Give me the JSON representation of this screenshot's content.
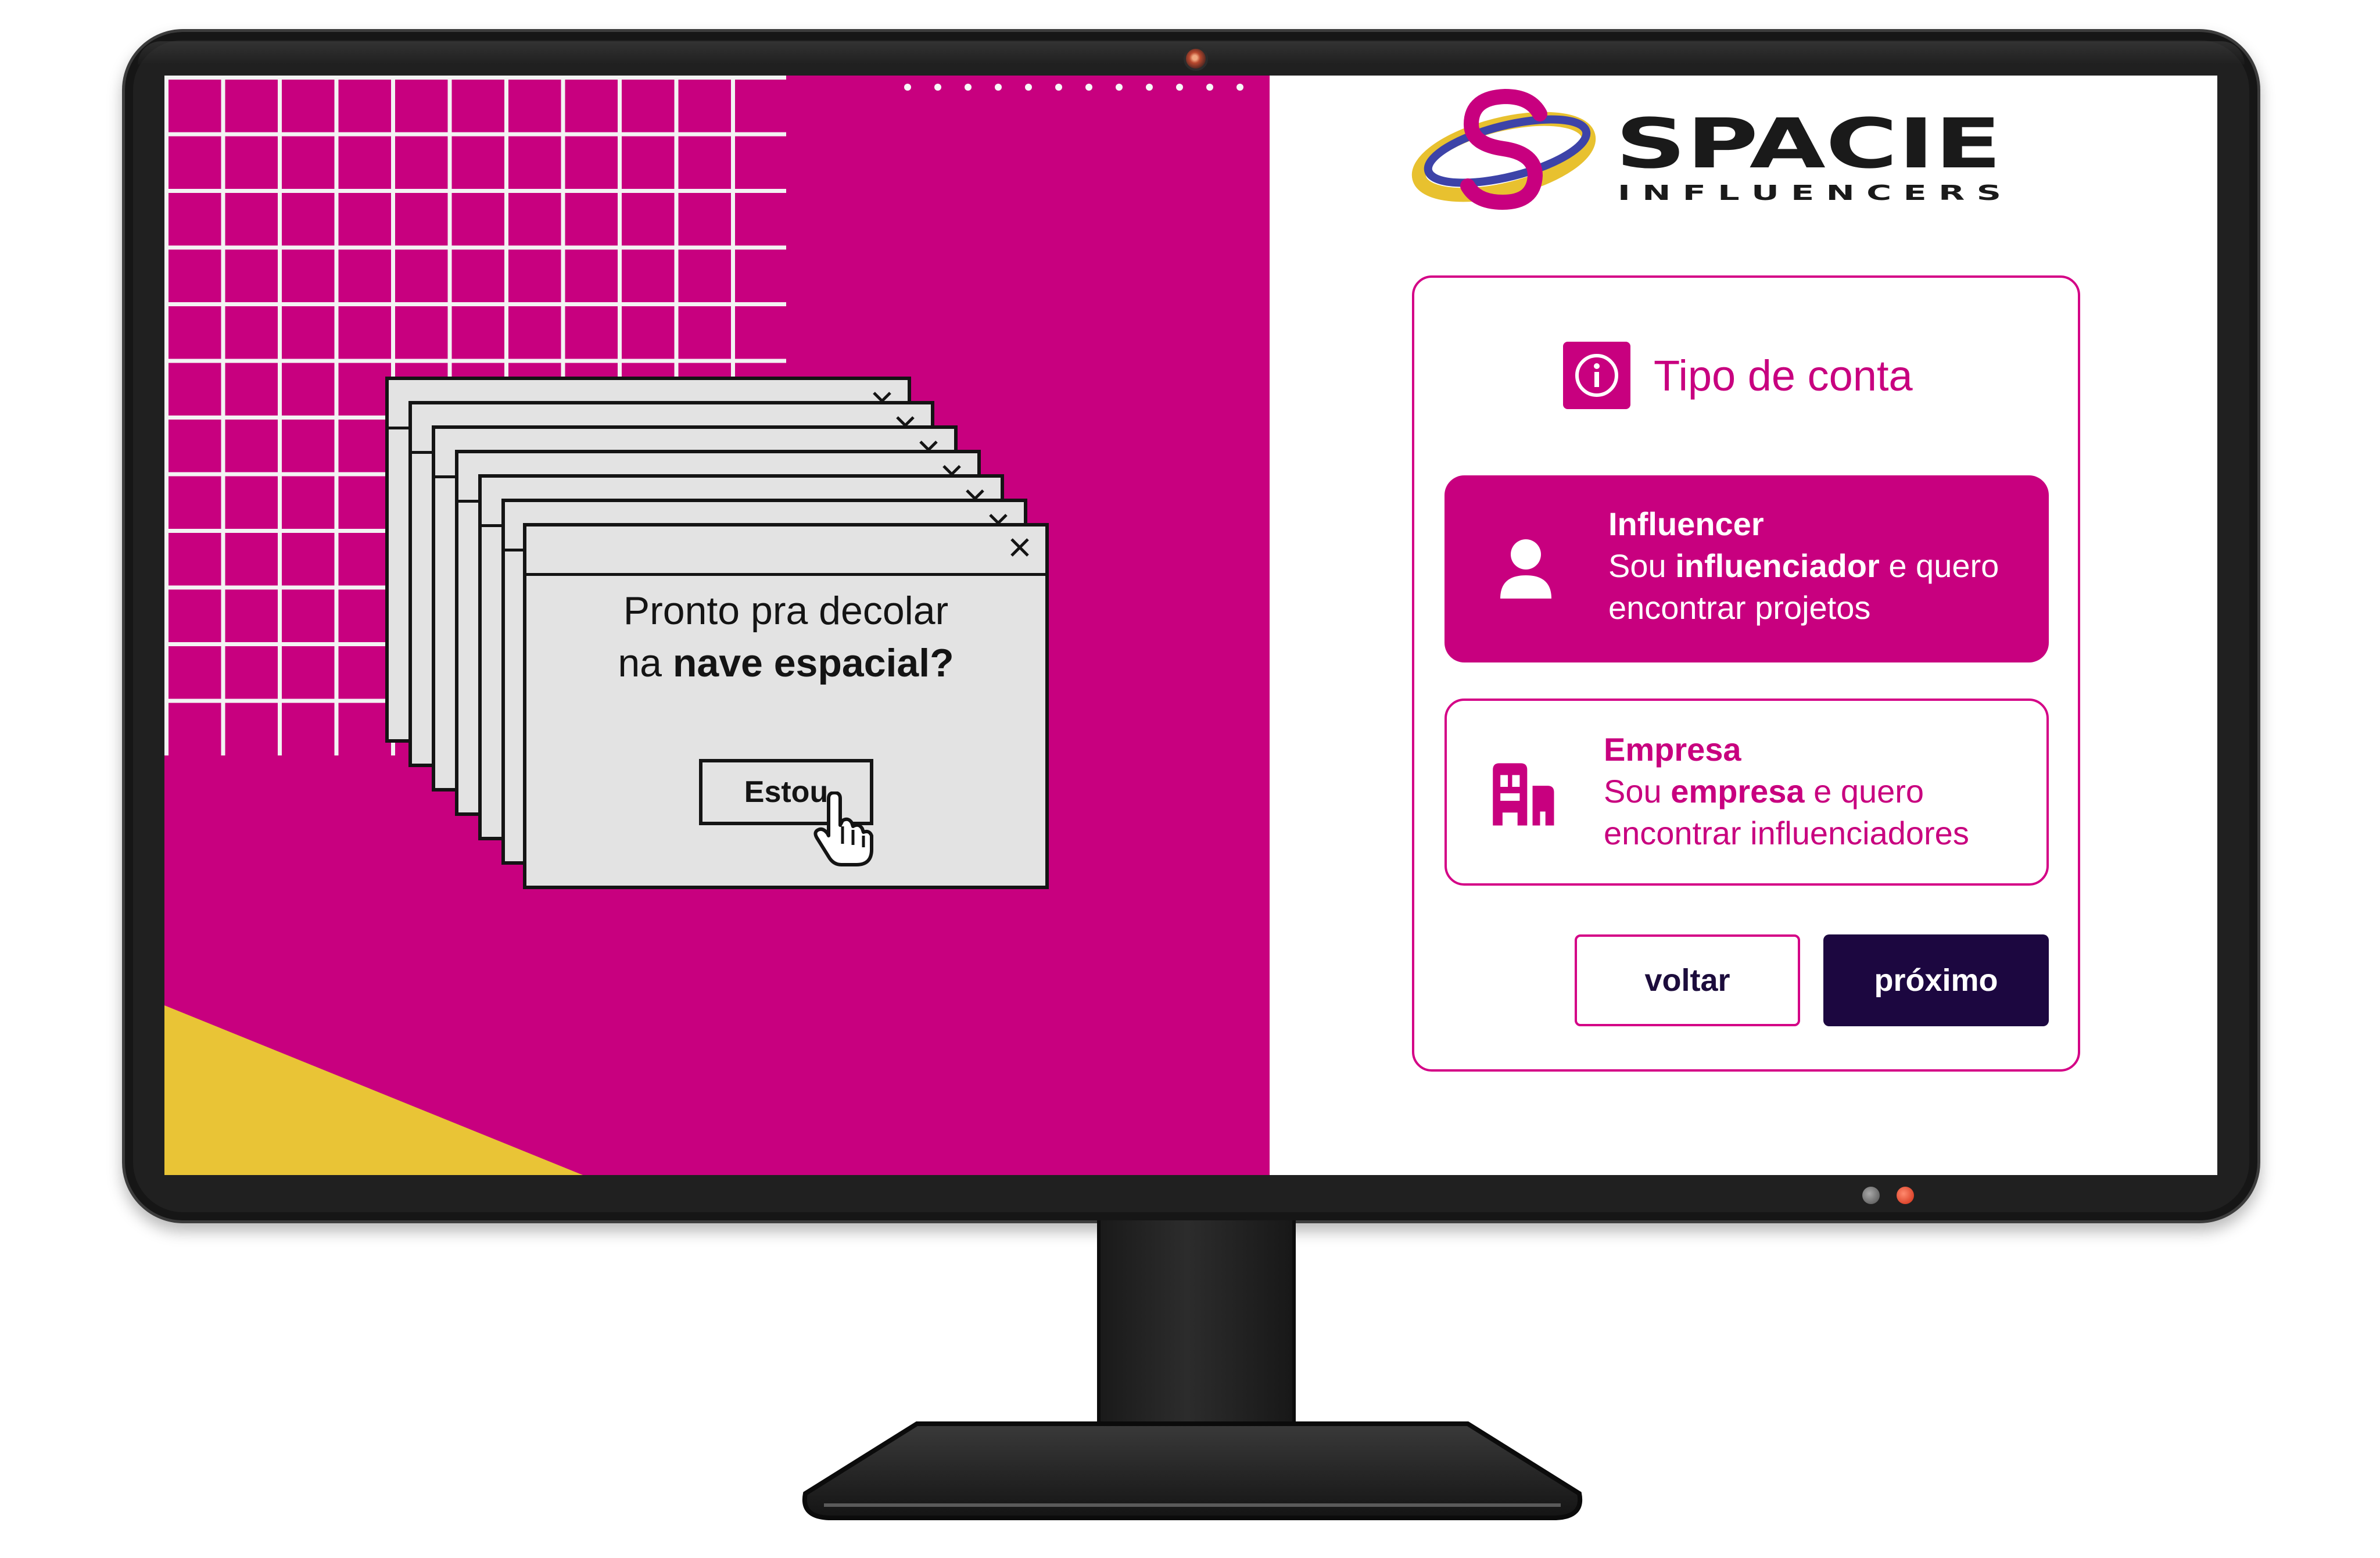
{
  "colors": {
    "brand_magenta": "#c8007f",
    "brand_navy": "#1c0740",
    "accent_yellow": "#e9c436",
    "bezel": "#202020"
  },
  "popup": {
    "line1": "Pronto pra decolar",
    "line2_prefix": "na ",
    "line2_bold": "nave espacial?",
    "button_label": "Estou"
  },
  "logo": {
    "word": "SPACIE",
    "tagline": "I N F L U E N C E R S"
  },
  "card": {
    "title": "Tipo de conta",
    "icon": "info-icon"
  },
  "options": [
    {
      "name": "Influencer",
      "desc_prefix": "Sou ",
      "desc_bold": "influenciador",
      "desc_suffix": " e quero encontrar projetos",
      "icon": "person-icon",
      "selected": true
    },
    {
      "name": "Empresa",
      "desc_prefix": "Sou ",
      "desc_bold": "empresa",
      "desc_suffix": " e quero encontrar influenciadores",
      "icon": "building-icon",
      "selected": false
    }
  ],
  "buttons": {
    "back": "voltar",
    "next": "próximo"
  }
}
